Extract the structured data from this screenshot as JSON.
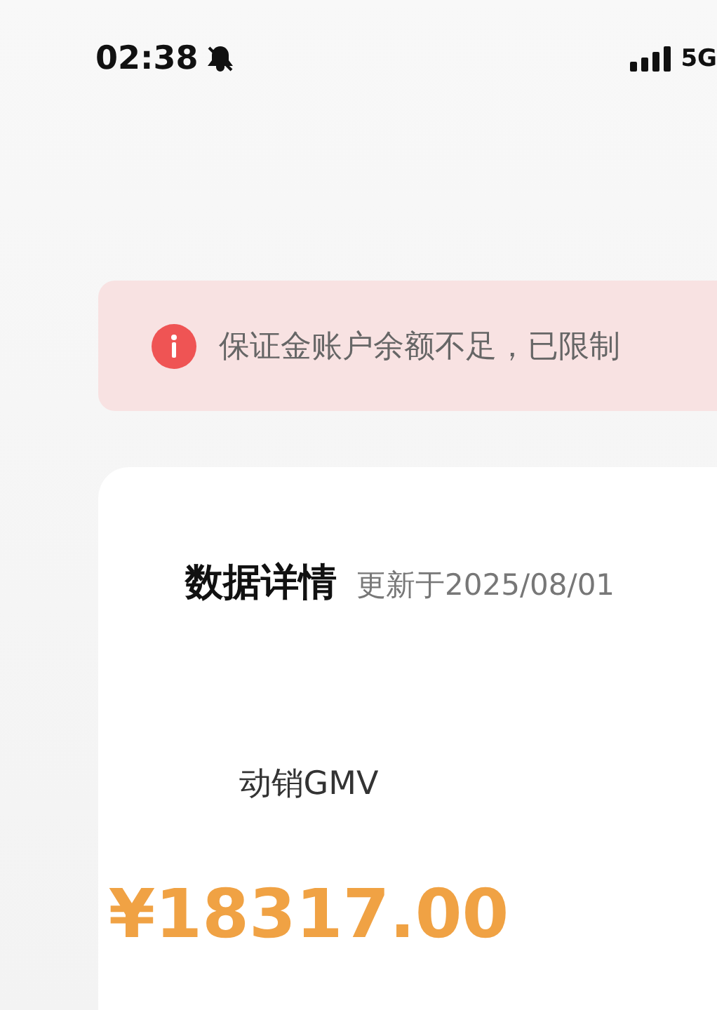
{
  "status_bar": {
    "time": "02:38",
    "network": "5G"
  },
  "alert": {
    "text": "保证金账户余额不足，已限制"
  },
  "card": {
    "title": "数据详情",
    "updated": "更新于2025/08/01",
    "metric": {
      "label": "动销GMV",
      "value": "¥18317.00"
    }
  }
}
